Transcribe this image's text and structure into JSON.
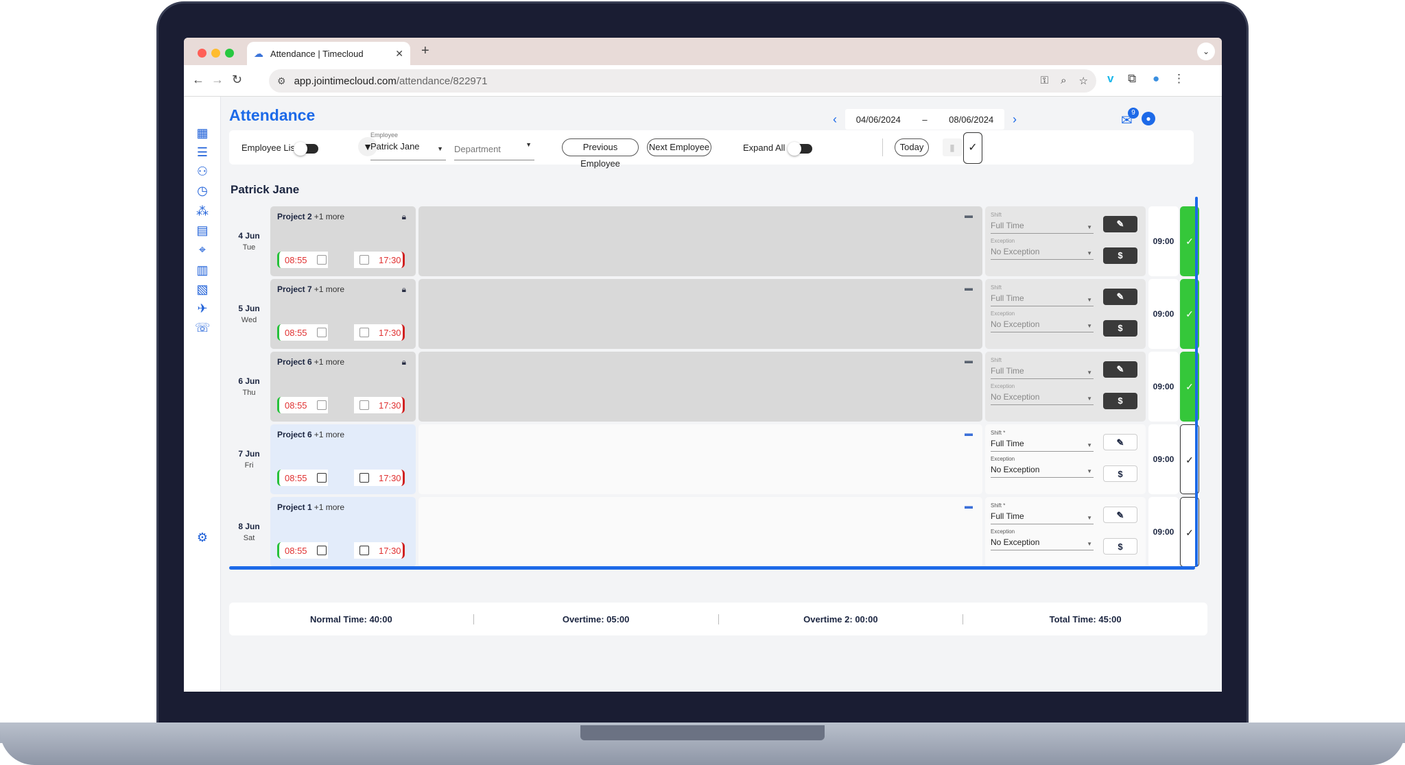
{
  "browser": {
    "tab_title": "Attendance | Timecloud",
    "url_host": "app.jointimecloud.com",
    "url_path": "/attendance/822971",
    "traffic_lights": [
      "#ff5f57",
      "#febc2e",
      "#28c840"
    ]
  },
  "app": {
    "title": "Attendance",
    "date_from": "04/06/2024",
    "date_sep": "–",
    "date_to": "08/06/2024",
    "notifications": "9"
  },
  "toolbar": {
    "employee_list": "Employee List",
    "employee_caption": "Employee",
    "employee_value": "Patrick Jane",
    "department_placeholder": "Department",
    "prev_employee": "Previous Employee",
    "next_employee": "Next Employee",
    "expand_all": "Expand All",
    "today": "Today"
  },
  "employee_name": "Patrick Jane",
  "rows": [
    {
      "date": "4 Jun",
      "weekday": "Tue",
      "project": "Project 2",
      "more": "+1 more",
      "in": "08:55",
      "out": "17:30",
      "shift_cap": "Shift",
      "shift": "Full Time",
      "exc_cap": "Exception",
      "exception": "No Exception",
      "hours": "09:00",
      "approved": true
    },
    {
      "date": "5 Jun",
      "weekday": "Wed",
      "project": "Project 7",
      "more": "+1 more",
      "in": "08:55",
      "out": "17:30",
      "shift_cap": "Shift",
      "shift": "Full Time",
      "exc_cap": "Exception",
      "exception": "No Exception",
      "hours": "09:00",
      "approved": true
    },
    {
      "date": "6 Jun",
      "weekday": "Thu",
      "project": "Project 6",
      "more": "+1 more",
      "in": "08:55",
      "out": "17:30",
      "shift_cap": "Shift",
      "shift": "Full Time",
      "exc_cap": "Exception",
      "exception": "No Exception",
      "hours": "09:00",
      "approved": true
    },
    {
      "date": "7 Jun",
      "weekday": "Fri",
      "project": "Project 6",
      "more": "+1 more",
      "in": "08:55",
      "out": "17:30",
      "shift_cap": "Shift *",
      "shift": "Full Time",
      "exc_cap": "Exception",
      "exception": "No Exception",
      "hours": "09:00",
      "approved": false
    },
    {
      "date": "8 Jun",
      "weekday": "Sat",
      "project": "Project 1",
      "more": "+1 more",
      "in": "08:55",
      "out": "17:30",
      "shift_cap": "Shift *",
      "shift": "Full Time",
      "exc_cap": "Exception",
      "exception": "No Exception",
      "hours": "09:00",
      "approved": false
    }
  ],
  "summary": {
    "normal": "Normal Time: 40:00",
    "overtime": "Overtime: 05:00",
    "overtime2": "Overtime 2: 00:00",
    "total": "Total Time: 45:00"
  },
  "sidebar_icons": [
    "dashboard-icon",
    "list-icon",
    "team-icon",
    "clock-icon",
    "group-icon",
    "calendar-icon",
    "location-icon",
    "building-icon",
    "document-icon",
    "flight-icon",
    "phone-icon"
  ],
  "colors": {
    "accent": "#1d6ae8",
    "approved": "#35c73a",
    "clock_in": "#26c13a",
    "clock_out": "#d02020"
  }
}
